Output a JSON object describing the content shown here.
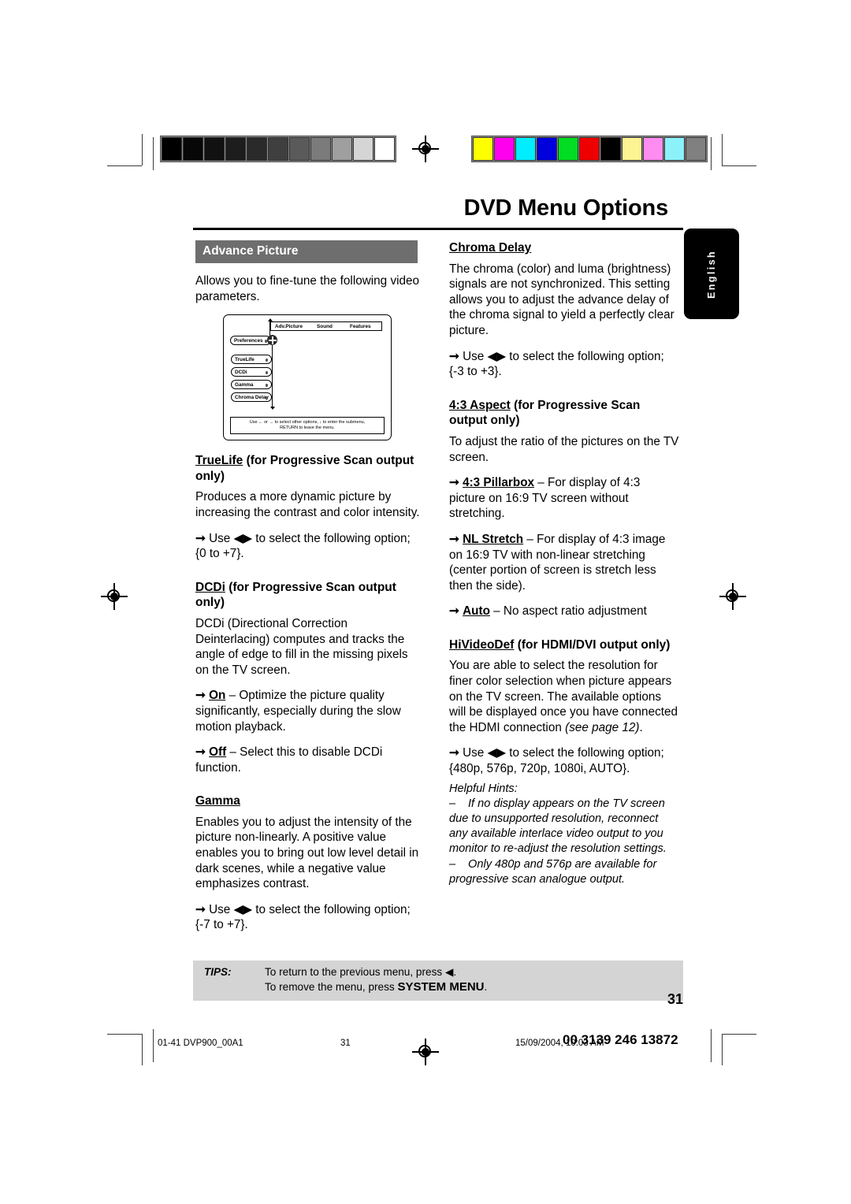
{
  "header": {
    "title": "DVD Menu Options",
    "language_tab": "English"
  },
  "left_column": {
    "section_band": "Advance Picture",
    "intro": "Allows you to fine-tune the following video parameters.",
    "osd": {
      "tabs": [
        "Adv.Picture",
        "Sound",
        "Features"
      ],
      "root_item": "Preferences",
      "items": [
        "TrueLife",
        "DCDi",
        "Gamma",
        "Chroma Delay"
      ],
      "footnote_line1": "Use ← or → to select other options, ↓ to enter the submenu,",
      "footnote_line2": "RETURN to leave the menu."
    },
    "truelife": {
      "heading_underline": "TrueLife",
      "heading_rest": " (for Progressive Scan output only)",
      "body": "Produces a more dynamic picture by increasing the contrast and color intensity.",
      "option": "Use ◀▶ to select the following option; {0 to +7}."
    },
    "dcdi": {
      "heading_underline": "DCDi",
      "heading_rest": " (for Progressive Scan output only)",
      "body": "DCDi (Directional Correction Deinterlacing) computes and tracks the angle of edge to fill in the missing pixels on the TV screen.",
      "option_on_label": "On",
      "option_on_text": " – Optimize the picture quality significantly, especially during the slow motion playback.",
      "option_off_label": "Off",
      "option_off_text": " – Select this to disable DCDi function."
    },
    "gamma": {
      "heading_underline": "Gamma",
      "heading_rest": "",
      "body": "Enables you to adjust the intensity of the picture non-linearly. A positive value enables you to bring out low level detail in dark scenes, while a negative value emphasizes contrast.",
      "option": "Use ◀▶ to select the following option; {-7 to +7}."
    }
  },
  "right_column": {
    "chroma_delay": {
      "heading_underline": "Chroma Delay",
      "heading_rest": "",
      "body": "The chroma (color) and luma (brightness) signals are not synchronized. This setting allows you to adjust the advance delay of the chroma signal to yield a perfectly clear picture.",
      "option": "Use ◀▶ to select the following option; {-3 to +3}."
    },
    "aspect": {
      "heading_underline": "4:3 Aspect",
      "heading_rest": " (for Progressive Scan output only)",
      "body": "To adjust the ratio of the pictures on the TV screen.",
      "option_pillarbox_label": "4:3 Pillarbox",
      "option_pillarbox_text": " – For display of 4:3 picture on 16:9 TV screen without stretching.",
      "option_nlstretch_label": "NL Stretch",
      "option_nlstretch_text": " – For display of 4:3 image on 16:9 TV with non-linear stretching (center portion of screen is stretch less then the side).",
      "option_auto_label": "Auto",
      "option_auto_text": " – No aspect ratio adjustment"
    },
    "hivideodef": {
      "heading_underline": "HiVideoDef",
      "heading_rest": " (for HDMI/DVI output only)",
      "body_part1": "You are able to select the resolution for finer color selection when picture appears on the TV screen. The available options will be displayed once you have connected the HDMI connection ",
      "body_italic": "(see page 12)",
      "body_part2": ".",
      "option": "Use ◀▶ to select the following option; {480p, 576p, 720p, 1080i, AUTO}."
    },
    "helpful_hints": {
      "title": "Helpful Hints:",
      "hint1": "If no display appears on the TV screen due to unsupported resolution, reconnect any available interlace video output to you monitor to re-adjust the resolution settings.",
      "hint2": "Only 480p and 576p are available for progressive scan analogue output."
    }
  },
  "tips": {
    "label": "TIPS:",
    "line1_before": "To return to the previous menu, press ",
    "line1_arrow": "◀",
    "line1_after": ".",
    "line2_before": "To remove the menu, press ",
    "line2_bold": "SYSTEM MENU",
    "line2_after": "."
  },
  "folio": "31",
  "production_footer": {
    "file": "01-41 DVP900_00A1",
    "page": "31",
    "date": "15/09/2004, 10:03 AM",
    "code": "00 3139 246 13872"
  },
  "calibration": {
    "grayscale": [
      "#000000",
      "#070707",
      "#111111",
      "#1d1d1d",
      "#2a2a2a",
      "#3f3f3f",
      "#5a5a5a",
      "#7b7b7b",
      "#9f9f9f",
      "#d5d5d5",
      "#ffffff"
    ],
    "colors": [
      "#ffff00",
      "#ff00ee",
      "#00eeff",
      "#0000dd",
      "#00dd22",
      "#ee0000",
      "#000000",
      "#fcf392",
      "#ff8cf0",
      "#8cf2fa",
      "#808080"
    ]
  }
}
